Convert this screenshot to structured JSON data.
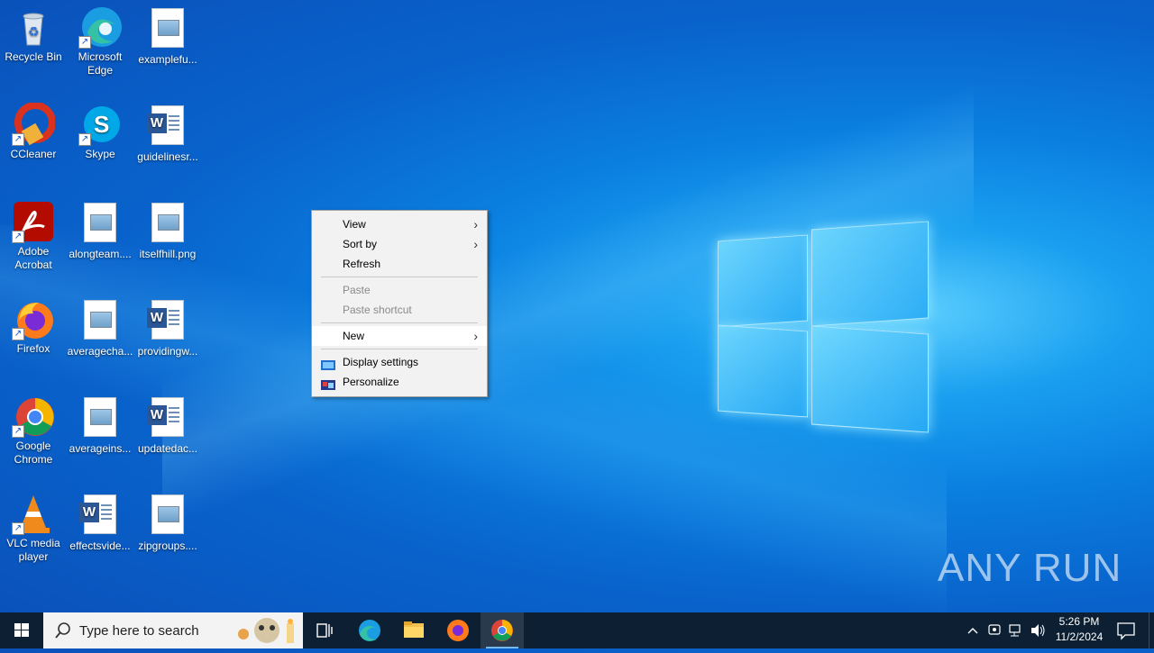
{
  "desktop": {
    "icons": [
      {
        "label": "Recycle Bin"
      },
      {
        "label": "Microsoft Edge"
      },
      {
        "label": "examplefu..."
      },
      {
        "label": "CCleaner"
      },
      {
        "label": "Skype"
      },
      {
        "label": "guidelinesr..."
      },
      {
        "label": "Adobe Acrobat"
      },
      {
        "label": "alongteam...."
      },
      {
        "label": "itselfhill.png"
      },
      {
        "label": "Firefox"
      },
      {
        "label": "averagecha..."
      },
      {
        "label": "providingw..."
      },
      {
        "label": "Google Chrome"
      },
      {
        "label": "averageins..."
      },
      {
        "label": "updatedac..."
      },
      {
        "label": "VLC media player"
      },
      {
        "label": "effectsvide..."
      },
      {
        "label": "zipgroups...."
      }
    ]
  },
  "context_menu": {
    "items": {
      "view": "View",
      "sort_by": "Sort by",
      "refresh": "Refresh",
      "paste": "Paste",
      "paste_shortcut": "Paste shortcut",
      "new": "New",
      "display_settings": "Display settings",
      "personalize": "Personalize"
    },
    "submenu_arrow": "›"
  },
  "taskbar": {
    "search_placeholder": "Type here to search",
    "time": "5:26 PM",
    "date": "11/2/2024"
  },
  "watermark": "ANY RUN",
  "colors": {
    "taskbar": "#0c1f33",
    "menu_bg": "#f2f2f2",
    "desktop_accent": "#0a7fe0"
  }
}
